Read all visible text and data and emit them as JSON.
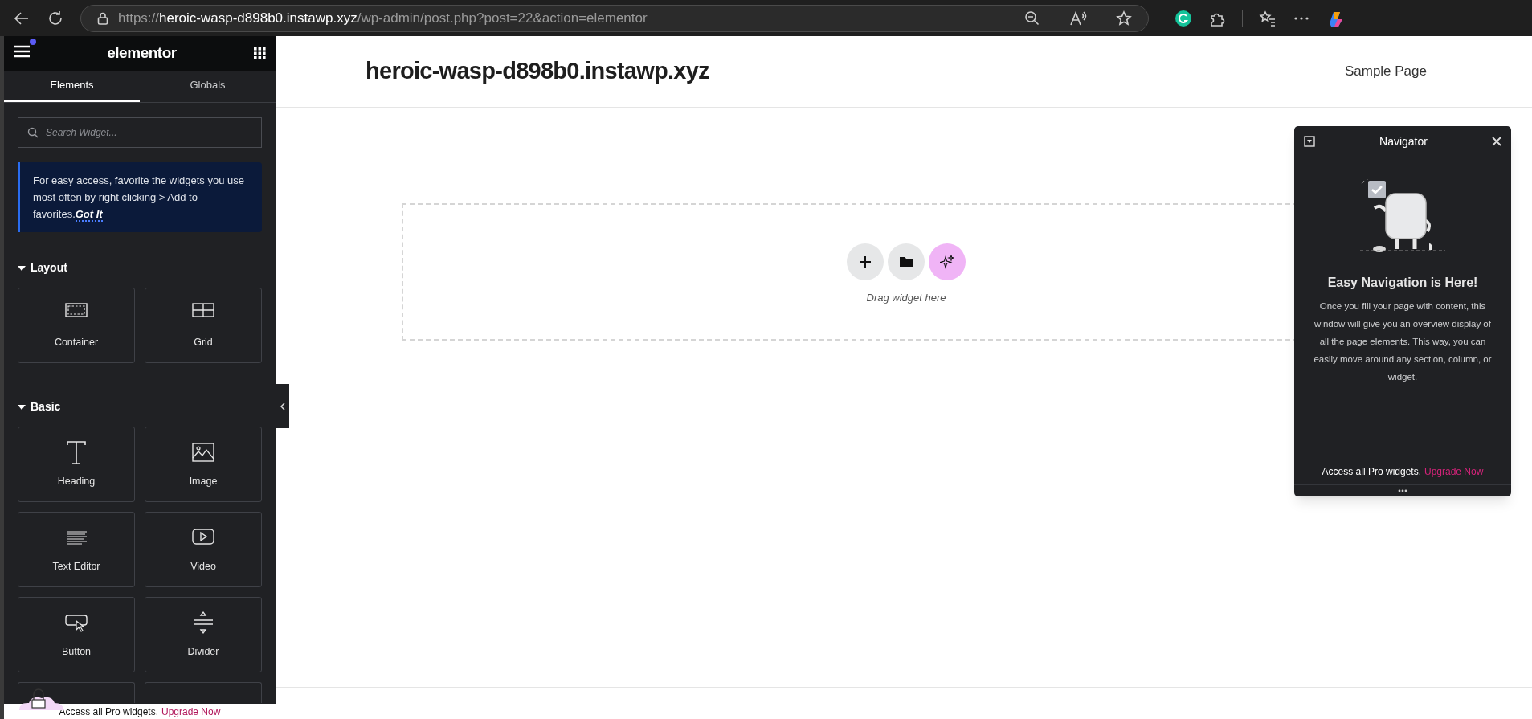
{
  "browser": {
    "url": {
      "scheme": "https://",
      "host": "heroic-wasp-d898b0.instawp.xyz",
      "path": "/wp-admin/post.php?post=22&action=elementor"
    }
  },
  "panel": {
    "logo": "elementor",
    "menu_notification": true,
    "tabs": [
      {
        "label": "Elements",
        "selected": true
      },
      {
        "label": "Globals",
        "selected": false
      }
    ],
    "search": {
      "placeholder": "Search Widget..."
    },
    "notice": {
      "text": "For easy access, favorite the widgets you use most often by right clicking > Add to favorites.",
      "link": "Got It"
    },
    "categories": [
      {
        "title": "Layout",
        "expanded": true,
        "widgets": [
          {
            "label": "Container",
            "kind": "container"
          },
          {
            "label": "Grid",
            "kind": "grid"
          }
        ]
      },
      {
        "title": "Basic",
        "expanded": true,
        "widgets": [
          {
            "label": "Heading",
            "kind": "heading"
          },
          {
            "label": "Image",
            "kind": "image"
          },
          {
            "label": "Text Editor",
            "kind": "text"
          },
          {
            "label": "Video",
            "kind": "video"
          },
          {
            "label": "Button",
            "kind": "button"
          },
          {
            "label": "Divider",
            "kind": "divider"
          }
        ]
      }
    ],
    "promo": {
      "text": "Access all Pro widgets.",
      "link": "Upgrade Now"
    }
  },
  "site": {
    "title": "heroic-wasp-d898b0.instawp.xyz",
    "menu": [
      "Sample Page"
    ],
    "dropzone": {
      "hint": "Drag widget here"
    }
  },
  "navigator": {
    "title": "Navigator",
    "heading": "Easy Navigation is Here!",
    "body": "Once you fill your page with content, this window will give you an overview display of all the page elements. This way, you can easily move around any section, column, or widget.",
    "promo": {
      "text": "Access all Pro widgets.",
      "link": "Upgrade Now"
    }
  }
}
